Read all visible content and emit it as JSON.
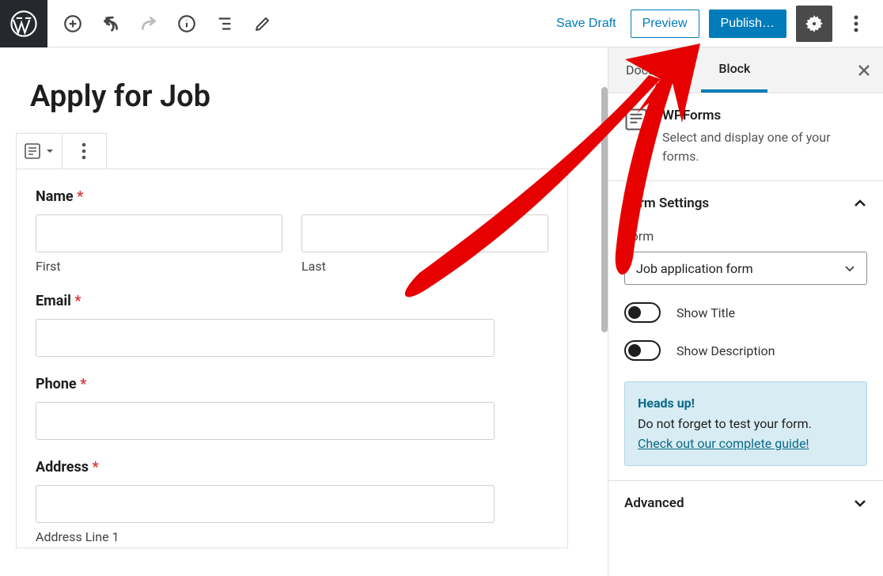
{
  "toolbar": {
    "save_draft": "Save Draft",
    "preview": "Preview",
    "publish": "Publish…"
  },
  "editor": {
    "page_title": "Apply for Job",
    "form": {
      "name_label": "Name",
      "first_label": "First",
      "last_label": "Last",
      "email_label": "Email",
      "phone_label": "Phone",
      "address_label": "Address",
      "address_line1_label": "Address Line 1"
    }
  },
  "sidebar": {
    "tabs": {
      "document": "Document",
      "block": "Block"
    },
    "block_info": {
      "name": "WPForms",
      "description": "Select and display one of your forms."
    },
    "form_settings": {
      "title": "Form Settings",
      "form_label": "Form",
      "form_value": "Job application form",
      "show_title": "Show Title",
      "show_description": "Show Description"
    },
    "notice": {
      "title": "Heads up!",
      "text": "Do not forget to test your form.",
      "link": "Check out our complete guide!"
    },
    "advanced": {
      "title": "Advanced"
    }
  }
}
